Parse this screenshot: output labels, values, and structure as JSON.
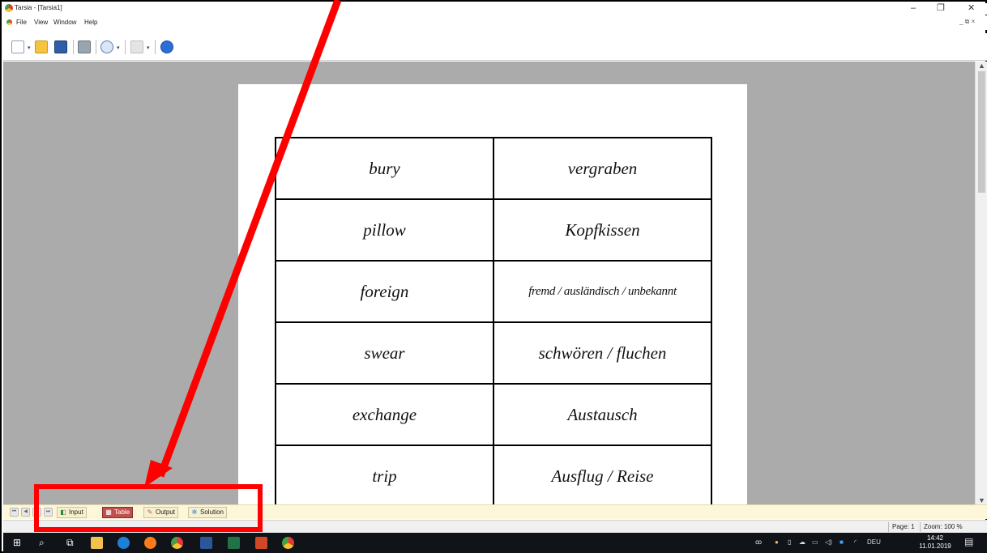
{
  "window": {
    "title": "Tarsia - [Tarsia1]",
    "controls": {
      "minimize": "–",
      "maximize": "❐",
      "close": "✕"
    },
    "mdi_controls": "_ ⧉ ×"
  },
  "menu": {
    "items": [
      "File",
      "View",
      "Window",
      "Help"
    ]
  },
  "toolbar": {
    "buttons": [
      "new-document",
      "open-folder",
      "save",
      "print",
      "zoom",
      "options",
      "help"
    ]
  },
  "cards": [
    {
      "english": "bury",
      "german": "vergraben"
    },
    {
      "english": "pillow",
      "german": "Kopfkissen"
    },
    {
      "english": "foreign",
      "german": "fremd / ausländisch / unbekannt"
    },
    {
      "english": "swear",
      "german": "schwören / fluchen"
    },
    {
      "english": "exchange",
      "german": "Austausch"
    },
    {
      "english": "trip",
      "german": "Ausflug / Reise"
    }
  ],
  "tabs": [
    {
      "label": "Input",
      "active": false
    },
    {
      "label": "Table",
      "active": true
    },
    {
      "label": "Output",
      "active": false
    },
    {
      "label": "Solution",
      "active": false
    }
  ],
  "status": {
    "page": "Page: 1",
    "zoom": "Zoom: 100 %"
  },
  "taskbar": {
    "language": "DEU",
    "time": "14:42",
    "date": "11.01.2019"
  },
  "annotation": {
    "color": "#ff0000"
  }
}
